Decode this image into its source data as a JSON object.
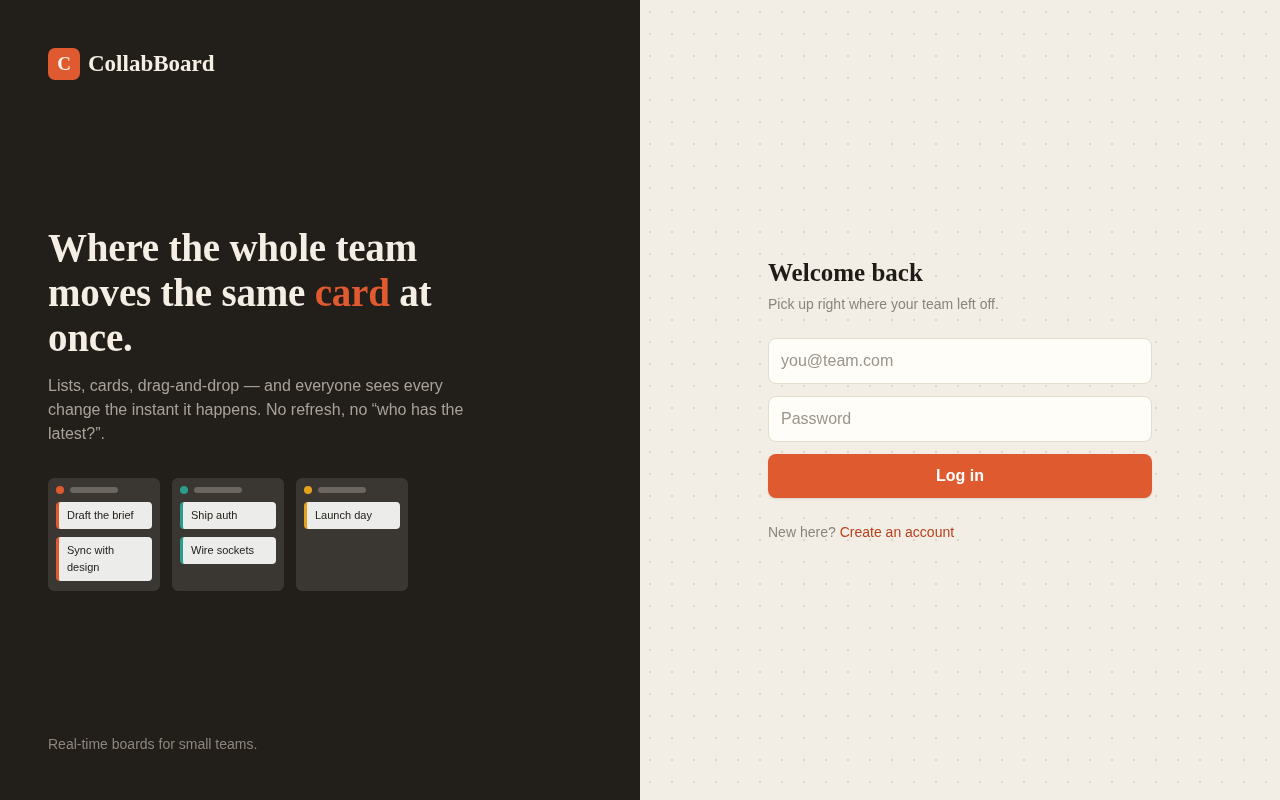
{
  "brand": {
    "logo_letter": "C",
    "name": "CollabBoard"
  },
  "hero": {
    "headline": [
      {
        "text": "Where the whole team moves the same",
        "highlight": false
      },
      {
        "text": "card",
        "highlight": true
      },
      {
        "text": "at once.",
        "highlight": false
      }
    ],
    "description": "Lists, cards, drag-and-drop — and everyone sees every change the instant it happens. No refresh, no “who has the latest?”."
  },
  "board_preview": {
    "columns": [
      {
        "color": "#e05a2f",
        "cards": [
          "Draft the brief",
          "Sync with design"
        ]
      },
      {
        "color": "#2a9d8f",
        "cards": [
          "Ship auth",
          "Wire sockets"
        ]
      },
      {
        "color": "#e3a21a",
        "cards": [
          "Launch day"
        ]
      }
    ]
  },
  "tagline": "Real-time boards for small teams.",
  "login": {
    "title": "Welcome back",
    "subtitle": "Pick up right where your team left off.",
    "email": {
      "placeholder": "you@team.com"
    },
    "password": {
      "placeholder": "Password"
    },
    "submit": "Log in",
    "signup": {
      "prompt": "New here?",
      "link": "Create an account"
    }
  }
}
